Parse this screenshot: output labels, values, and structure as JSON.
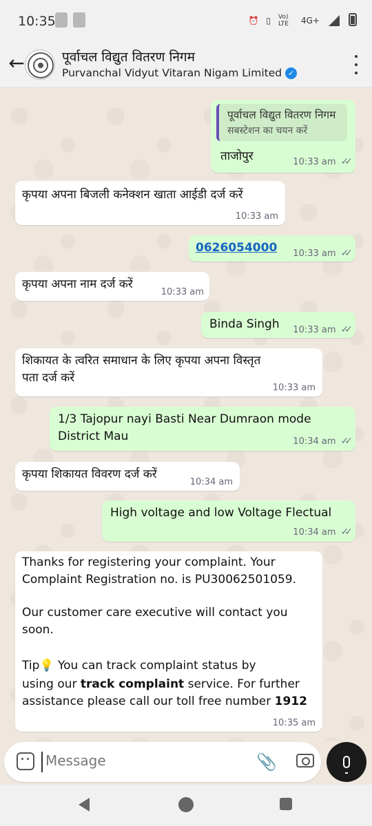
{
  "status_bar": {
    "time": "10:35",
    "network": "4G+",
    "volte": "Vo) LTE"
  },
  "header": {
    "title": "पूर्वाचल विद्युत वितरण निगम",
    "subtitle": "Purvanchal Vidyut Vitaran Nigam Limited"
  },
  "messages": [
    {
      "dir": "out",
      "quote_title": "पूर्वाचल विद्युत वितरण निगम",
      "quote_text": "सबस्टेशन का चयन करें",
      "text": "ताजोपुर",
      "time": "10:33 am"
    },
    {
      "dir": "in",
      "text": "कृपया अपना बिजली कनेक्शन खाता आईडी दर्ज करें",
      "time": "10:33 am"
    },
    {
      "dir": "out",
      "text": "0626054000",
      "time": "10:33 am"
    },
    {
      "dir": "in",
      "text": "कृपया अपना नाम दर्ज करें",
      "time": "10:33 am"
    },
    {
      "dir": "out",
      "text": "Binda Singh",
      "time": "10:33 am"
    },
    {
      "dir": "in",
      "line1": "शिकायत के त्वरित समाधान के लिए कृपया अपना विस्तृत",
      "line2": "पता दर्ज करें",
      "time": "10:33 am"
    },
    {
      "dir": "out",
      "line1": "1/3 Tajopur nayi Basti Near Dumraon mode",
      "line2": "District Mau",
      "time": "10:34 am"
    },
    {
      "dir": "in",
      "text": "कृपया शिकायत विवरण दर्ज करें",
      "time": "10:34 am"
    },
    {
      "dir": "out",
      "text": "High voltage and low Voltage Flectual",
      "time": "10:34 am"
    },
    {
      "dir": "in",
      "p1_line1": "Thanks for registering your complaint. Your",
      "p1_line2": "Complaint Registration no. is PU30062501059.",
      "p2_line1": "Our customer care executive will contact you",
      "p2_line2": "soon.",
      "p3_line1_a": "Tip",
      "p3_line1_b": " You can track complaint status by",
      "p3_line2_a": "using our ",
      "p3_line2_bold": "track complaint",
      "p3_line2_b": " service. For further",
      "p3_line3_a": "assistance please call our toll free number ",
      "p3_line3_bold": "1912",
      "time": "10:35 am"
    }
  ],
  "composer": {
    "placeholder": "Message"
  },
  "colors": {
    "incoming": "#ffffff",
    "outgoing": "#d9fdd3",
    "link": "#1565c0",
    "verified": "#1e88e5"
  }
}
